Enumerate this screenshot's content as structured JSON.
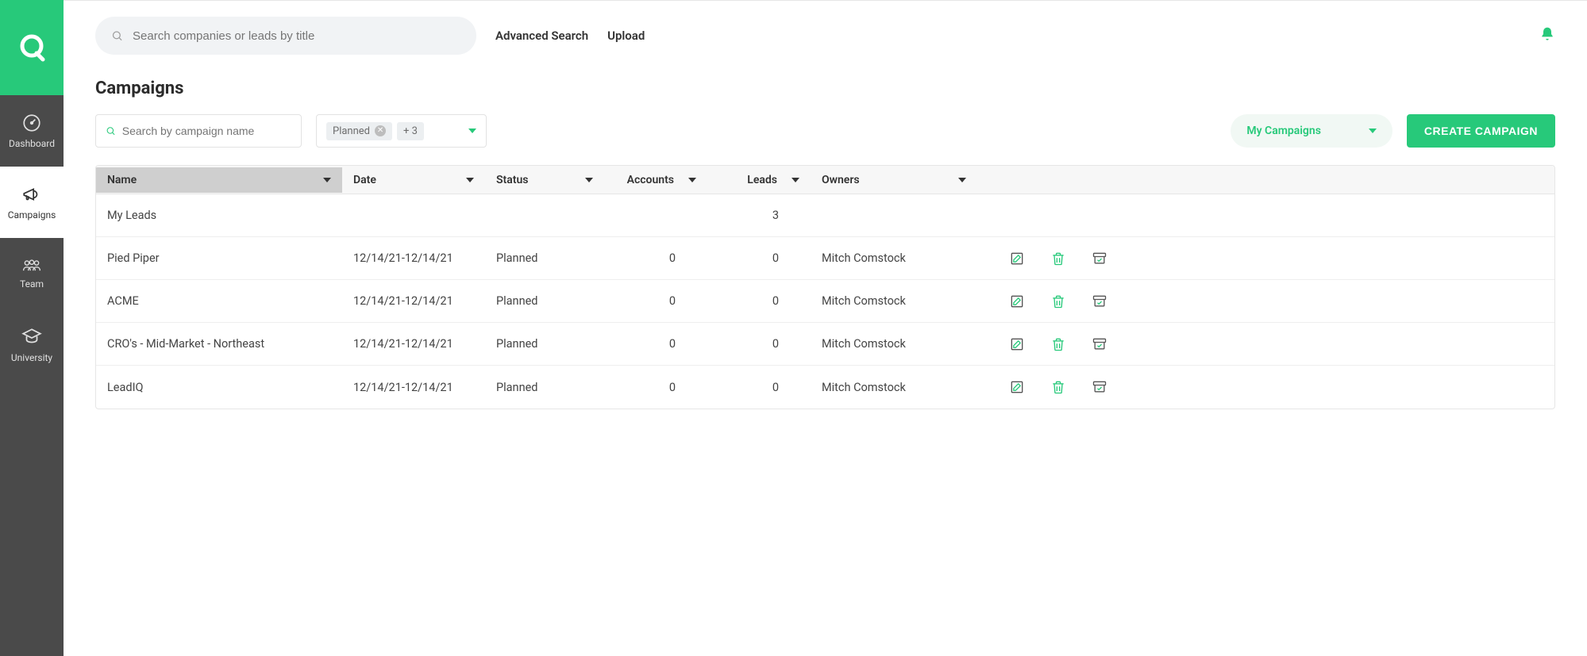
{
  "sidebar": {
    "items": [
      {
        "label": "Dashboard",
        "name": "sidebar-item-dashboard"
      },
      {
        "label": "Campaigns",
        "name": "sidebar-item-campaigns"
      },
      {
        "label": "Team",
        "name": "sidebar-item-team"
      },
      {
        "label": "University",
        "name": "sidebar-item-university"
      }
    ]
  },
  "topbar": {
    "search_placeholder": "Search companies or leads by title",
    "advanced_search": "Advanced Search",
    "upload": "Upload"
  },
  "page": {
    "title": "Campaigns"
  },
  "filters": {
    "name_search_placeholder": "Search by campaign name",
    "status_chip": "Planned",
    "status_more": "+ 3",
    "scope_label": "My Campaigns",
    "create_button": "CREATE CAMPAIGN"
  },
  "columns": {
    "name": "Name",
    "date": "Date",
    "status": "Status",
    "accounts": "Accounts",
    "leads": "Leads",
    "owners": "Owners"
  },
  "rows": [
    {
      "name": "My Leads",
      "date": "",
      "status": "",
      "accounts": "",
      "leads": "3",
      "owners": "",
      "actions": false
    },
    {
      "name": "Pied Piper",
      "date": "12/14/21-12/14/21",
      "status": "Planned",
      "accounts": "0",
      "leads": "0",
      "owners": "Mitch Comstock",
      "actions": true
    },
    {
      "name": "ACME",
      "date": "12/14/21-12/14/21",
      "status": "Planned",
      "accounts": "0",
      "leads": "0",
      "owners": "Mitch Comstock",
      "actions": true
    },
    {
      "name": "CRO's - Mid-Market - Northeast",
      "date": "12/14/21-12/14/21",
      "status": "Planned",
      "accounts": "0",
      "leads": "0",
      "owners": "Mitch Comstock",
      "actions": true
    },
    {
      "name": "LeadIQ",
      "date": "12/14/21-12/14/21",
      "status": "Planned",
      "accounts": "0",
      "leads": "0",
      "owners": "Mitch Comstock",
      "actions": true
    }
  ],
  "colors": {
    "accent": "#27c97a"
  }
}
